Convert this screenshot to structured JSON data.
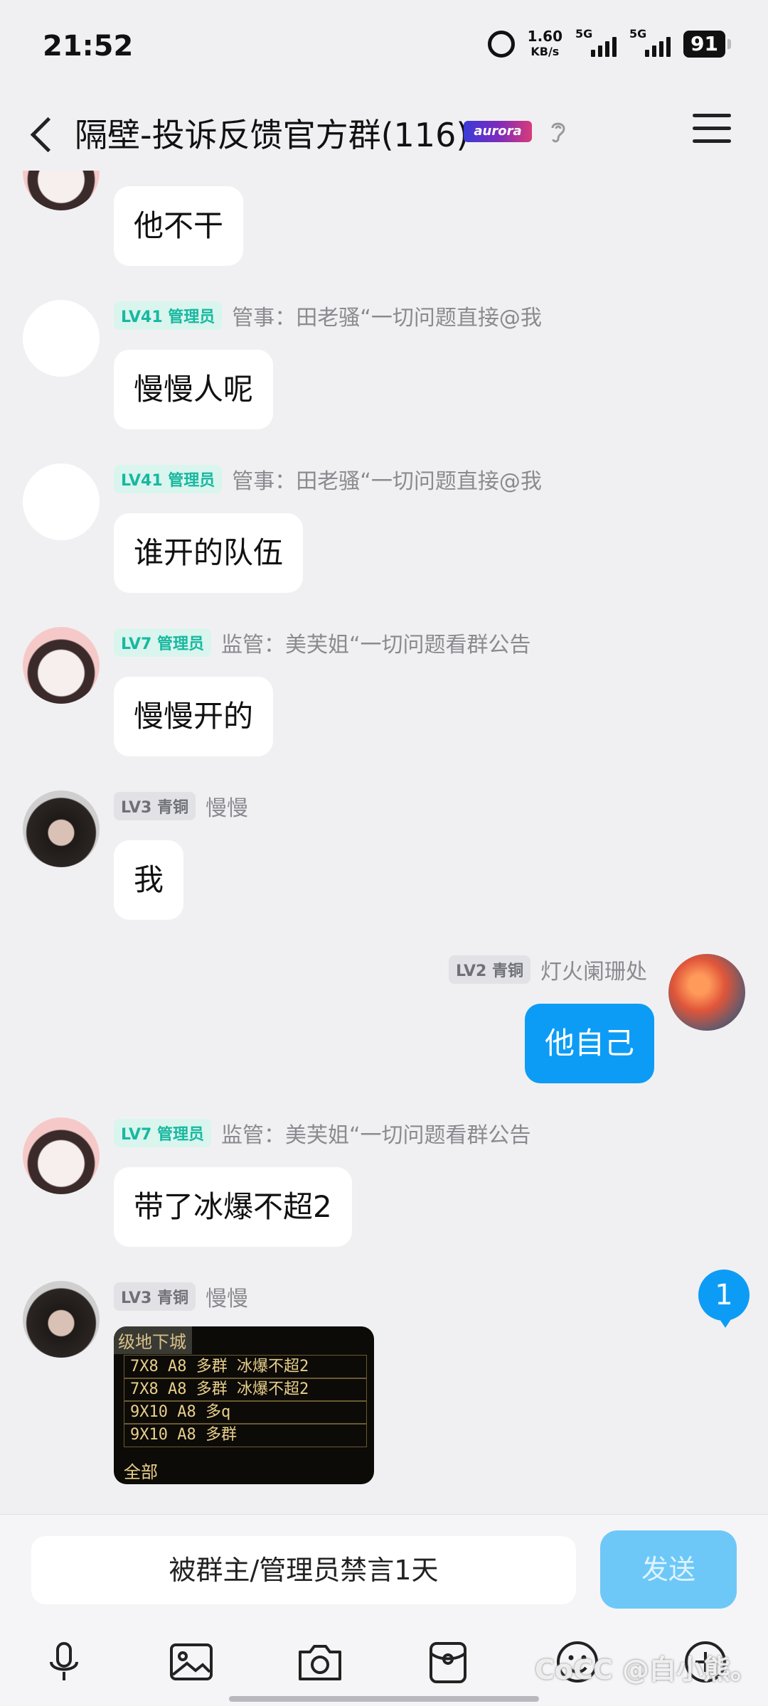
{
  "status": {
    "time": "21:52",
    "net_speed_value": "1.60",
    "net_speed_unit": "KB/s",
    "sim1": "5G",
    "sim2": "5G",
    "battery": "91"
  },
  "header": {
    "title": "隔壁-投诉反馈官方群(116)",
    "badge": "aurora"
  },
  "messages": [
    {
      "text": "他不干"
    },
    {
      "level": "LV41 管理员",
      "name": "管事：田老骚“一切问题直接@我",
      "text": "慢慢人呢"
    },
    {
      "level": "LV41 管理员",
      "name": "管事：田老骚“一切问题直接@我",
      "text": "谁开的队伍"
    },
    {
      "level": "LV7 管理员",
      "name": "监管：美芙姐“一切问题看群公告",
      "text": "慢慢开的"
    },
    {
      "level": "LV3 青铜",
      "name": "慢慢",
      "text": "我"
    },
    {
      "level": "LV2 青铜",
      "name": "灯火阑珊处",
      "text": "他自己"
    },
    {
      "level": "LV7 管理员",
      "name": "监管：美芙姐“一切问题看群公告",
      "text": "带了冰爆不超2"
    },
    {
      "level": "LV3 青铜",
      "name": "慢慢"
    }
  ],
  "image_message": {
    "header": "级地下城",
    "lines": [
      "7X8 A8 多群 冰爆不超2",
      "7X8 A8 多群 冰爆不超2",
      "9X10 A8 多q",
      "9X10 A8 多群"
    ],
    "footer": "全部"
  },
  "unread_count": "1",
  "input": {
    "muted_text": "被群主/管理员禁言1天",
    "send_label": "发送"
  },
  "watermark": "CoCC @白小熊。"
}
